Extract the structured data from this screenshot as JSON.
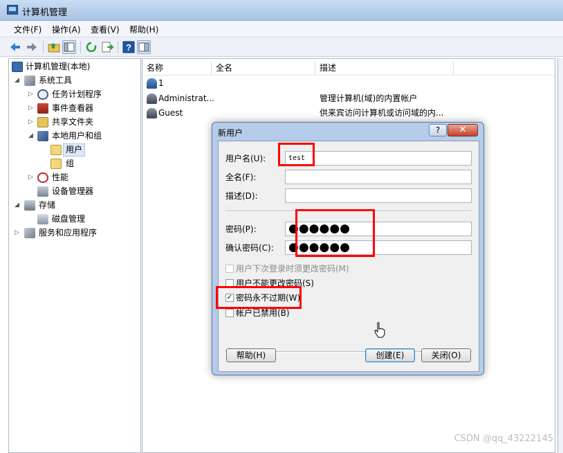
{
  "window": {
    "title": "计算机管理"
  },
  "menu": [
    "文件(F)",
    "操作(A)",
    "查看(V)",
    "帮助(H)"
  ],
  "toolbar": {
    "buttons": [
      "back-arrow-icon",
      "forward-arrow-icon",
      "up-folder-icon",
      "show-hide-tree-icon",
      "refresh-icon",
      "export-list-icon",
      "help-icon",
      "properties-icon"
    ]
  },
  "tree": {
    "root": "计算机管理(本地)",
    "system_tools": "系统工具",
    "task_scheduler": "任务计划程序",
    "event_viewer": "事件查看器",
    "shared_folders": "共享文件夹",
    "local_users": "本地用户和组",
    "users": "用户",
    "groups": "组",
    "performance": "性能",
    "device_manager": "设备管理器",
    "storage": "存储",
    "disk_management": "磁盘管理",
    "services_apps": "服务和应用程序"
  },
  "list": {
    "headers": {
      "name": "名称",
      "fullname": "全名",
      "description": "描述"
    },
    "rows": [
      {
        "name": "1",
        "description": ""
      },
      {
        "name": "Administrat...",
        "description": "管理计算机(域)的内置帐户"
      },
      {
        "name": "Guest",
        "description": "供来宾访问计算机或访问域的内..."
      }
    ]
  },
  "dialog": {
    "title": "新用户",
    "help_glyph": "?",
    "close_glyph": "✕",
    "username_label": "用户名(U):",
    "username_value": "test",
    "fullname_label": "全名(F):",
    "description_label": "描述(D):",
    "password_label": "密码(P):",
    "password_value": "●●●●●●",
    "confirm_label": "确认密码(C):",
    "confirm_value": "●●●●●●",
    "checkboxes": {
      "must_change": {
        "label": "用户下次登录时须更改密码(M)",
        "checked": false,
        "enabled": false
      },
      "cannot_change": {
        "label": "用户不能更改密码(S)",
        "checked": false,
        "enabled": true
      },
      "never_expires": {
        "label": "密码永不过期(W)",
        "checked": true,
        "enabled": true
      },
      "disabled": {
        "label": "帐户已禁用(B)",
        "checked": false,
        "enabled": true
      }
    },
    "check_glyph": "✓",
    "help_button": "帮助(H)",
    "create_button": "创建(E)",
    "close_button": "关闭(O)"
  },
  "watermark": "CSDN @qq_43222145",
  "colors": {
    "highlight": "#ff0000",
    "title_gradient": "#c9dcf2"
  }
}
